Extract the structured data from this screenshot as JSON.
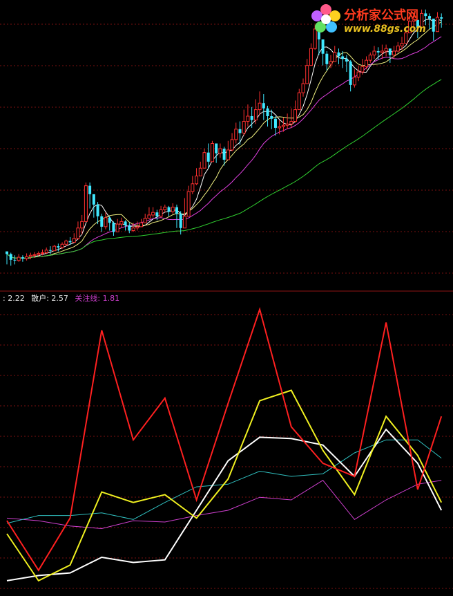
{
  "watermark": {
    "name": "分析家公式网",
    "url": "www.88gs.com"
  },
  "indicator": {
    "items": [
      {
        "text": ": 2.22",
        "color": "#e8e8e8"
      },
      {
        "text": "散户: 2.57",
        "color": "#e8e8e8"
      },
      {
        "text": "关注线: 1.81",
        "color": "#d040d0"
      }
    ]
  },
  "colors": {
    "up_candle": "#ff3030",
    "down_candle": "#40e8ff",
    "ma5": "#ffffff",
    "ma10": "#f0f080",
    "ma20": "#e040e0",
    "ma60": "#30d030",
    "red_line": "#ff2020",
    "yellow_line": "#f0f020",
    "white_line": "#ffffff",
    "cyan_line": "#30c0c0",
    "magenta_line": "#d040d0",
    "grid": "#7a1010",
    "separator": "#901515"
  },
  "chart_data": [
    {
      "type": "candlestick",
      "title": "",
      "grid": true,
      "x": [
        0,
        1,
        2,
        3,
        4,
        5,
        6,
        7,
        8,
        9,
        10,
        11,
        12,
        13,
        14,
        15,
        16,
        17,
        18,
        19,
        20,
        21,
        22,
        23,
        24,
        25,
        26,
        27,
        28,
        29,
        30,
        31,
        32,
        33,
        34,
        35,
        36,
        37,
        38,
        39,
        40,
        41,
        42,
        43,
        44,
        45,
        46,
        47,
        48,
        49,
        50,
        51,
        52,
        53,
        54,
        55,
        56,
        57,
        58,
        59,
        60,
        61,
        62,
        63,
        64,
        65,
        66,
        67,
        68,
        69,
        70,
        71,
        72,
        73,
        74,
        75,
        76,
        77,
        78,
        79,
        80,
        81,
        82,
        83,
        84,
        85,
        86,
        87,
        88,
        89,
        90,
        91,
        92,
        93,
        94,
        95,
        96,
        97,
        98,
        99,
        100,
        101,
        102,
        103,
        104,
        105,
        106,
        107,
        108,
        109,
        110
      ],
      "close": [
        40,
        31,
        30,
        35,
        33,
        36,
        38,
        39,
        41,
        42,
        46,
        45,
        52,
        50,
        55,
        60,
        58,
        64,
        80,
        90,
        145,
        132,
        116,
        98,
        82,
        96,
        88,
        74,
        86,
        90,
        84,
        76,
        80,
        82,
        88,
        95,
        100,
        104,
        98,
        108,
        112,
        105,
        112,
        102,
        80,
        98,
        136,
        148,
        160,
        172,
        196,
        182,
        210,
        195,
        202,
        185,
        200,
        216,
        232,
        226,
        244,
        252,
        246,
        262,
        272,
        264,
        252,
        248,
        234,
        236,
        238,
        240,
        244,
        262,
        288,
        302,
        330,
        356,
        386,
        370,
        348,
        332,
        336,
        350,
        344,
        340,
        336,
        300,
        312,
        320,
        328,
        338,
        346,
        352,
        350,
        352,
        356,
        346,
        352,
        360,
        364,
        380,
        398,
        400,
        388,
        410,
        406,
        402,
        382,
        404,
        402
      ],
      "high": [
        44,
        42,
        38,
        40,
        38,
        41,
        42,
        43,
        44,
        47,
        50,
        52,
        54,
        56,
        58,
        62,
        66,
        72,
        90,
        100,
        150,
        150,
        126,
        120,
        102,
        104,
        98,
        90,
        94,
        96,
        92,
        88,
        88,
        90,
        94,
        102,
        112,
        112,
        108,
        114,
        116,
        114,
        118,
        116,
        106,
        126,
        145,
        160,
        172,
        182,
        202,
        210,
        214,
        205,
        210,
        205,
        214,
        226,
        242,
        244,
        262,
        270,
        266,
        278,
        290,
        286,
        268,
        262,
        252,
        246,
        250,
        256,
        264,
        276,
        294,
        310,
        340,
        364,
        392,
        392,
        370,
        352,
        346,
        360,
        356,
        352,
        346,
        338,
        324,
        330,
        340,
        344,
        350,
        360,
        358,
        362,
        362,
        356,
        360,
        366,
        374,
        388,
        404,
        406,
        400,
        416,
        416,
        410,
        400,
        412,
        410
      ],
      "low": [
        24,
        22,
        24,
        28,
        28,
        30,
        32,
        34,
        36,
        38,
        40,
        40,
        46,
        44,
        48,
        52,
        54,
        58,
        62,
        70,
        106,
        110,
        96,
        86,
        74,
        78,
        76,
        68,
        74,
        80,
        76,
        72,
        74,
        76,
        82,
        88,
        94,
        96,
        92,
        96,
        104,
        98,
        102,
        80,
        70,
        80,
        110,
        132,
        146,
        160,
        176,
        172,
        184,
        180,
        188,
        176,
        186,
        198,
        210,
        208,
        222,
        236,
        234,
        240,
        254,
        246,
        236,
        232,
        222,
        224,
        228,
        232,
        234,
        242,
        262,
        282,
        304,
        330,
        354,
        346,
        330,
        322,
        326,
        336,
        332,
        326,
        320,
        290,
        296,
        306,
        316,
        324,
        334,
        340,
        338,
        340,
        344,
        334,
        340,
        350,
        354,
        366,
        380,
        384,
        372,
        394,
        392,
        386,
        368,
        386,
        388
      ]
    },
    {
      "type": "line",
      "title": "",
      "grid": true,
      "x": [
        0,
        8,
        16,
        24,
        32,
        40,
        48,
        56,
        64,
        72,
        80,
        88,
        96,
        104,
        110
      ],
      "series": [
        {
          "name": "",
          "values": [
            1.46,
            1.44,
            1.4,
            1.38,
            1.44,
            1.43,
            1.48,
            1.52,
            1.62,
            1.6,
            1.75,
            1.45,
            1.6,
            1.72,
            1.75
          ]
        },
        {
          "name": "",
          "values": [
            1.42,
            1.48,
            1.48,
            1.5,
            1.45,
            1.58,
            1.7,
            1.72,
            1.82,
            1.78,
            1.8,
            1.96,
            2.06,
            2.06,
            1.92
          ]
        },
        {
          "name": "",
          "values": [
            0.98,
            1.02,
            1.04,
            1.16,
            1.12,
            1.14,
            1.52,
            1.9,
            2.08,
            2.07,
            2.02,
            1.78,
            2.14,
            1.88,
            1.52
          ]
        },
        {
          "name": "",
          "values": [
            1.34,
            0.98,
            1.1,
            1.66,
            1.58,
            1.64,
            1.46,
            1.76,
            2.36,
            2.44,
            1.98,
            1.64,
            2.24,
            1.94,
            1.58
          ]
        },
        {
          "name": "",
          "values": [
            1.44,
            1.06,
            1.46,
            2.9,
            2.06,
            2.38,
            1.6,
            2.34,
            3.06,
            2.16,
            1.88,
            1.78,
            2.96,
            1.68,
            2.24
          ]
        }
      ]
    }
  ]
}
